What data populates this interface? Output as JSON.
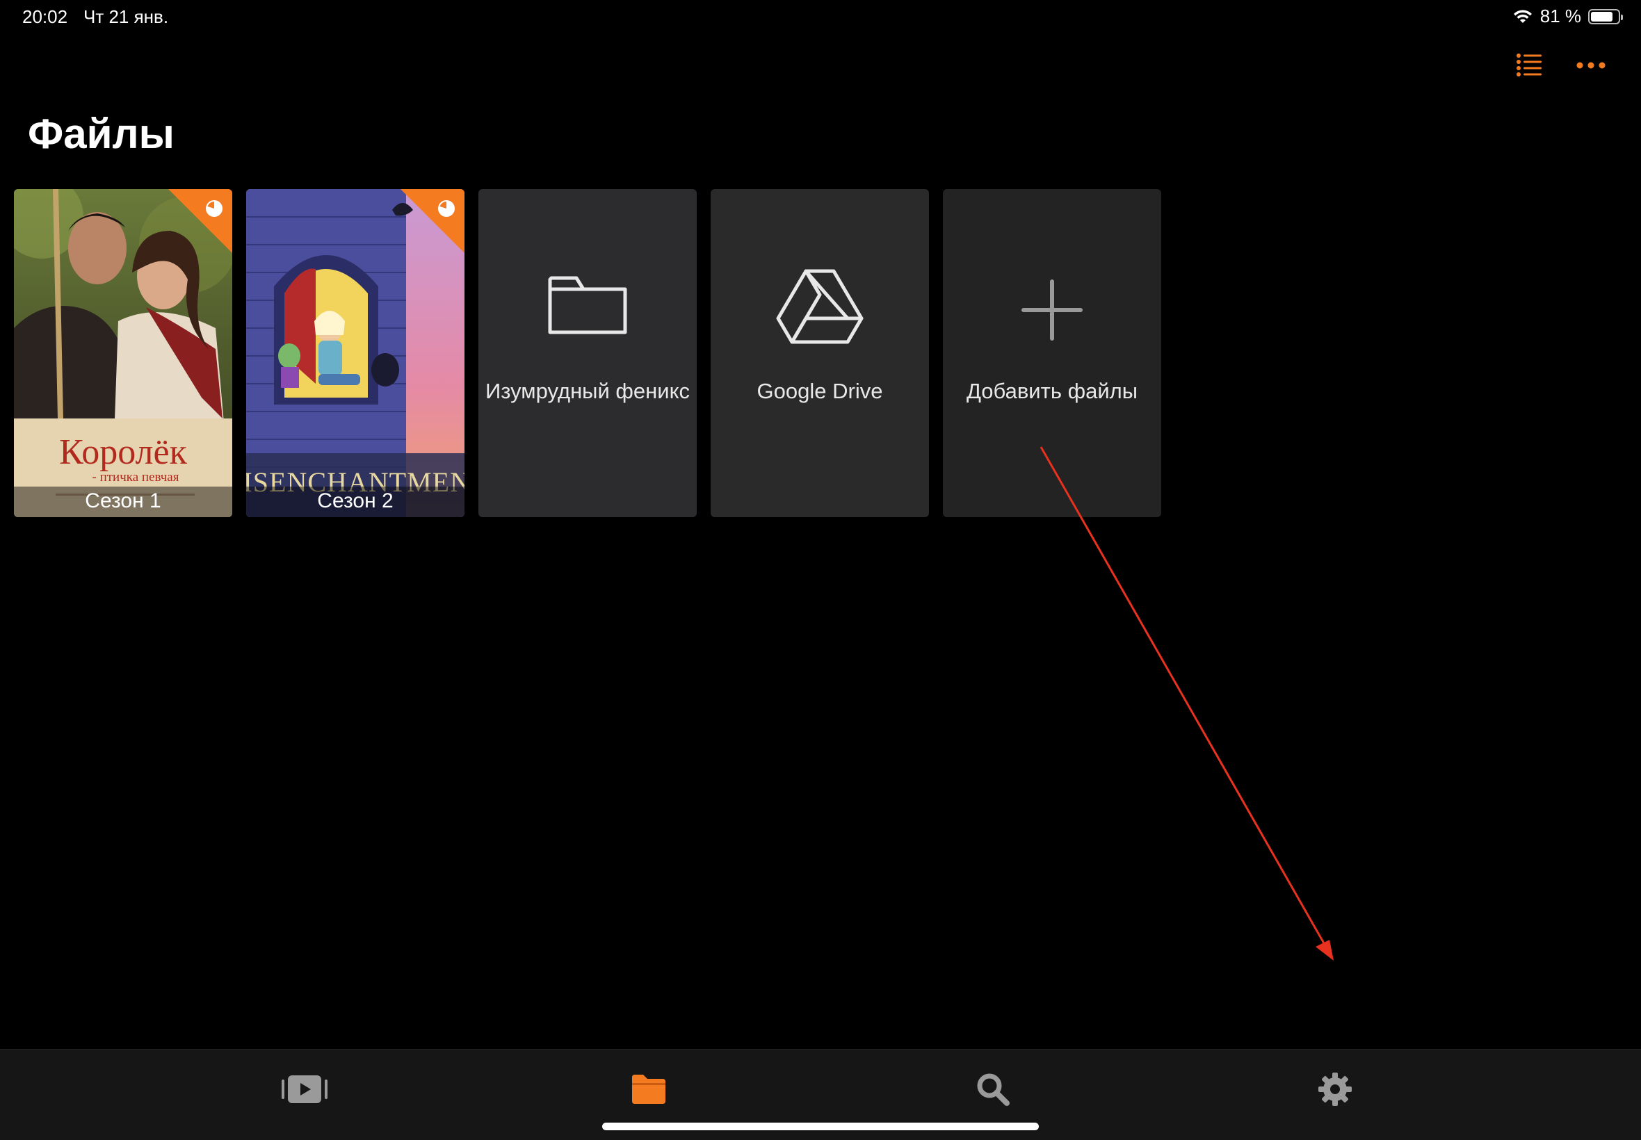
{
  "status_bar": {
    "time": "20:02",
    "date": "Чт 21 янв.",
    "battery_text": "81 %",
    "battery_level": 0.81
  },
  "header": {
    "title": "Файлы",
    "list_icon": "list-icon",
    "more_icon": "ellipsis-icon"
  },
  "tiles": [
    {
      "type": "media",
      "label": "Сезон 1",
      "poster": "korolek-poster",
      "badge": "progress-pie-icon"
    },
    {
      "type": "media",
      "label": "Сезон 2",
      "poster": "disenchantment-poster",
      "badge": "progress-pie-icon"
    },
    {
      "type": "folder",
      "label": "Изумрудный феникс",
      "icon": "folder-icon"
    },
    {
      "type": "cloud",
      "label": "Google Drive",
      "icon": "google-drive-icon"
    },
    {
      "type": "add",
      "label": "Добавить файлы",
      "icon": "plus-icon"
    }
  ],
  "poster_texts": {
    "korolek_title": "Королёк",
    "korolek_subtitle": "- птичка певчая",
    "disenchantment_title": "DISENCHANTMENT"
  },
  "tab_bar": {
    "tabs": [
      {
        "name": "video",
        "icon": "video-library-icon",
        "active": false
      },
      {
        "name": "files",
        "icon": "folder-icon",
        "active": true
      },
      {
        "name": "search",
        "icon": "search-icon",
        "active": false
      },
      {
        "name": "settings",
        "icon": "gear-icon",
        "active": false
      }
    ]
  },
  "colors": {
    "accent": "#f47b20",
    "tile_bg": "#2c2c2e",
    "tab_bar_bg": "#161616",
    "annotation": "#e8321f",
    "inactive_icon": "#9a9a9a"
  }
}
